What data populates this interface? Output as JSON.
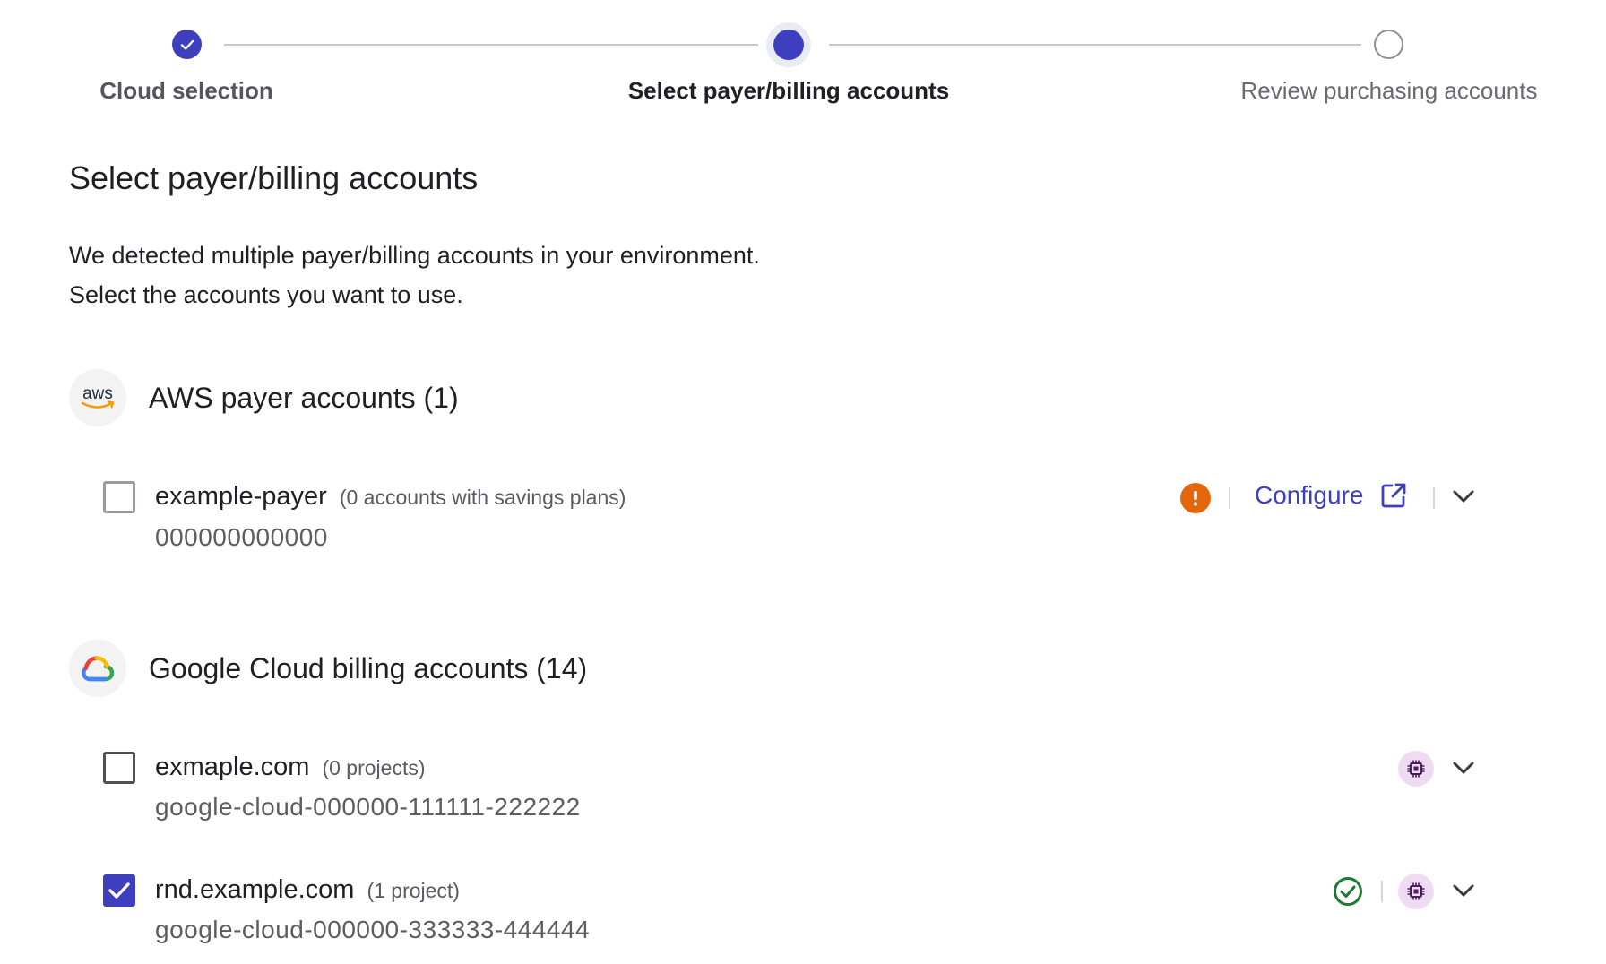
{
  "stepper": {
    "steps": [
      {
        "label": "Cloud selection",
        "state": "completed"
      },
      {
        "label": "Select payer/billing accounts",
        "state": "current"
      },
      {
        "label": "Review purchasing accounts",
        "state": "upcoming"
      }
    ]
  },
  "page": {
    "title": "Select payer/billing accounts",
    "intro_line1": "We detected multiple payer/billing accounts in your environment.",
    "intro_line2": "Select the accounts you want to use."
  },
  "colors": {
    "accent": "#3d3fbf",
    "warning": "#e3650c",
    "success": "#1e7a33",
    "chip_bg": "#efdcf3",
    "chip_fg": "#6a2a7a"
  },
  "aws": {
    "logo_text": "aws",
    "title": "AWS payer accounts (1)",
    "accounts": [
      {
        "name": "example-payer",
        "meta": "(0 accounts with savings plans)",
        "id": "000000000000",
        "checked": false,
        "status_icon": "warning-icon",
        "action_label": "Configure",
        "action_icon": "external-link-icon"
      }
    ]
  },
  "gcp": {
    "title": "Google Cloud billing accounts (14)",
    "accounts": [
      {
        "name": "exmaple.com",
        "meta": "(0 projects)",
        "id": "google-cloud-000000-111111-222222",
        "checked": false,
        "icons": [
          "chip-icon"
        ]
      },
      {
        "name": "rnd.example.com",
        "meta": "(1 project)",
        "id": "google-cloud-000000-333333-444444",
        "checked": true,
        "icons": [
          "check-circle-icon",
          "chip-icon"
        ]
      }
    ]
  }
}
